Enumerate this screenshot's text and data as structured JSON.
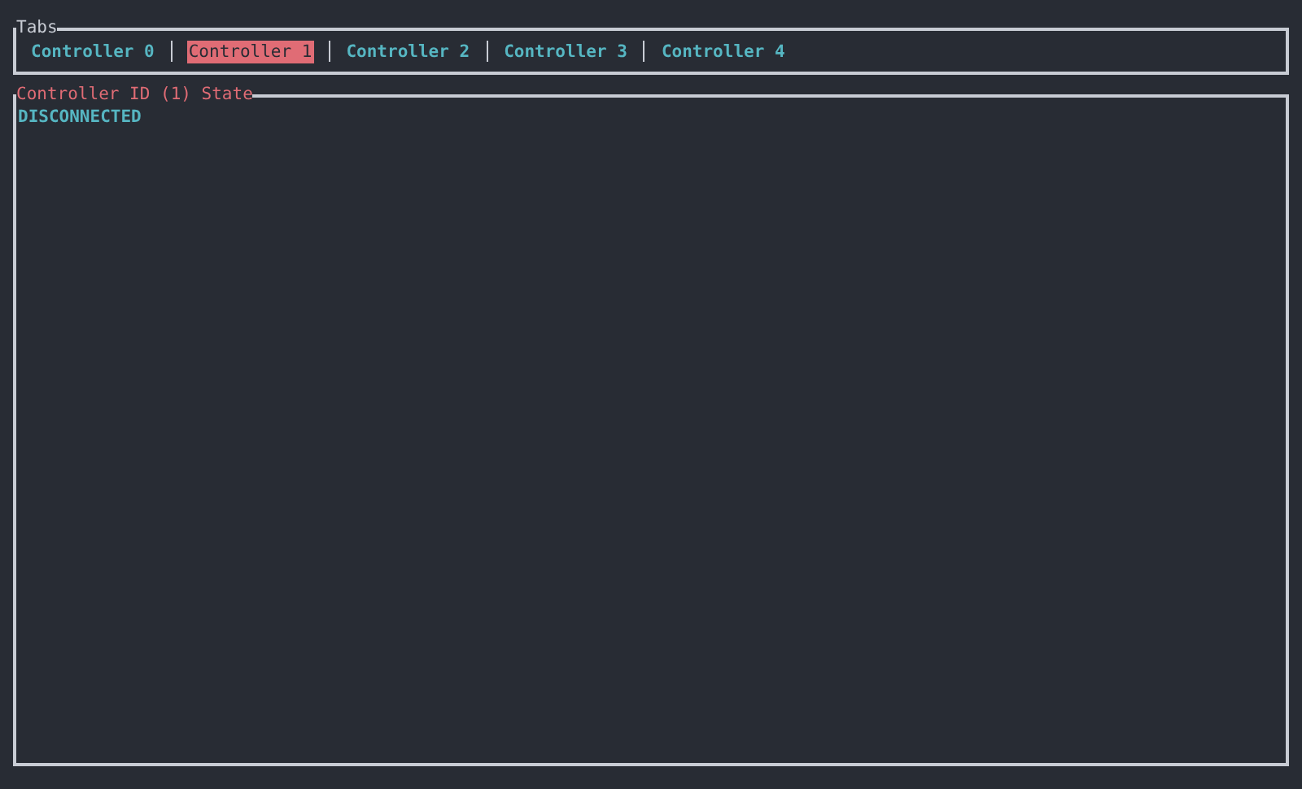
{
  "tabs_panel": {
    "title": "Tabs",
    "tabs": [
      {
        "label": "Controller 0",
        "selected": false
      },
      {
        "label": "Controller 1",
        "selected": true
      },
      {
        "label": "Controller 2",
        "selected": false
      },
      {
        "label": "Controller 3",
        "selected": false
      },
      {
        "label": "Controller 4",
        "selected": false
      }
    ]
  },
  "state_panel": {
    "title": "Controller ID (1) State",
    "state": "DISCONNECTED"
  }
}
